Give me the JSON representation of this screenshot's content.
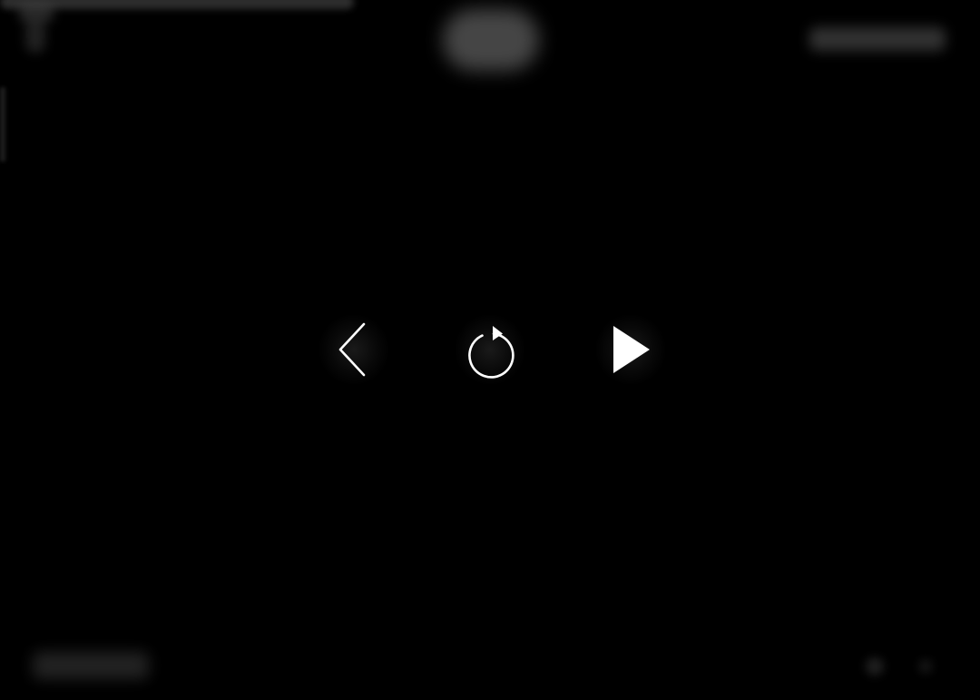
{
  "player": {
    "background_color": "#000000",
    "icon_color": "#ffffff",
    "controls": {
      "previous": {
        "icon": "chevron-left-icon"
      },
      "replay": {
        "icon": "replay-icon"
      },
      "play": {
        "icon": "play-icon"
      }
    }
  }
}
